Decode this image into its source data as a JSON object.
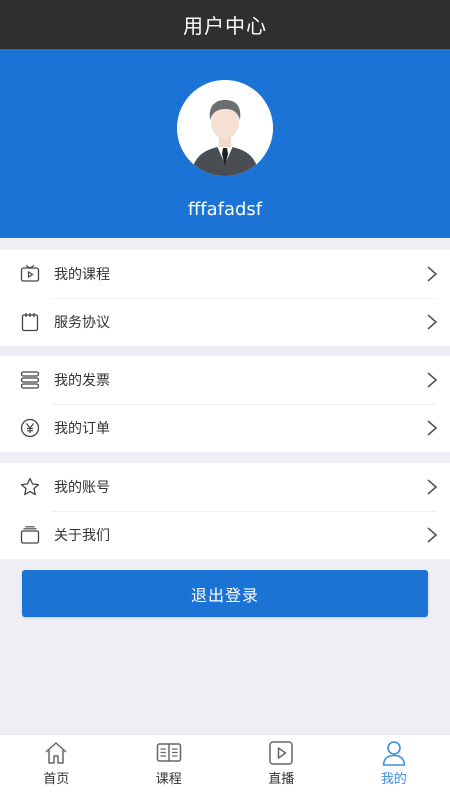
{
  "header": {
    "title": "用户中心"
  },
  "profile": {
    "username": "fffafadsf"
  },
  "menu": {
    "group1": [
      {
        "label": "我的课程",
        "icon": "tv-icon"
      },
      {
        "label": "服务协议",
        "icon": "notepad-icon"
      }
    ],
    "group2": [
      {
        "label": "我的发票",
        "icon": "stack-icon"
      },
      {
        "label": "我的订单",
        "icon": "yen-icon"
      }
    ],
    "group3": [
      {
        "label": "我的账号",
        "icon": "star-icon"
      },
      {
        "label": "关于我们",
        "icon": "cards-icon"
      }
    ]
  },
  "logout_label": "退出登录",
  "tabs": [
    {
      "label": "首页",
      "icon": "home-icon",
      "active": false
    },
    {
      "label": "课程",
      "icon": "book-icon",
      "active": false
    },
    {
      "label": "直播",
      "icon": "play-icon",
      "active": false
    },
    {
      "label": "我的",
      "icon": "user-icon",
      "active": true
    }
  ],
  "colors": {
    "brand_blue": "#1a73d5",
    "header_dark": "#2f2f2f",
    "active_tab": "#3a8fe0",
    "page_bg": "#efeef4"
  }
}
